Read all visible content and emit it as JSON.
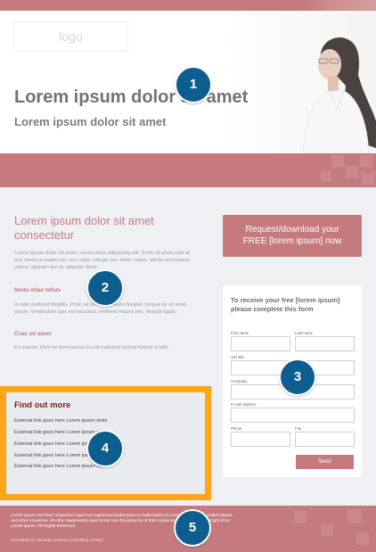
{
  "logo": "logo",
  "hero": {
    "title": "Lorem ipsum dolor sit amet",
    "subtitle": "Lorem ipsum dolor sit amet"
  },
  "main": {
    "title": "Lorem ipsum dolor sit amet consectetur",
    "para1": "Lorem ipsum dolor sit amet, consectetur adipiscing elit. Proin sit amet velit at orci rhoncus mattis nec non nulla. Integer nec dolor metus. Morbi sed mauris varius, aliquam leo et, aliquam dolor.",
    "heading2": "Nulla vitae tellus",
    "para2": "In odio eleifend fringilla. Proin sit sit amet mauris feugiat congue sit sit amet ipsum. Vestibulum quis est faucibus, eleifend massa nec, feugiat ligula.",
    "heading3": "Cras sit amet",
    "para3": "Ex mauris. Duis sit amet purus eu elit euismod lacinia finibus a felis."
  },
  "cta": {
    "line1": "Request/download your",
    "line2": "FREE [lorem ipsum] now"
  },
  "form": {
    "heading": "To receive your free [lorem ipsum] please complete this form",
    "first_name": "First name",
    "last_name": "Last name",
    "job_title": "Job title",
    "company": "Company",
    "email": "E-mail address",
    "phone": "Phone",
    "fax": "Fax",
    "send": "Send"
  },
  "findout": {
    "title": "Find out more",
    "links": [
      "External link goes here Lorem ipsum dolor",
      "External link goes here Lorem ipsum dolor",
      "External link goes here Lorem ipsum dolor",
      "External link goes here Lorem ipsum dolor",
      "External link goes here Lorem ipsum dolor"
    ]
  },
  "footer": {
    "legal": "Lorem ipsum and their respective logos are registered trademarks or trademarks of Lorem ipsum in the United States and other countries. All other trademarks used herein are the property of their respective owners. (c) Copyright 2014 Lorem ipsum. All Rights Reserved.",
    "developer": "Developed by Strategic Internet Consulting Limited"
  },
  "badges": [
    "1",
    "2",
    "3",
    "4",
    "5"
  ],
  "colors": {
    "accent": "#c57b7e",
    "badge": "#0e5d8f",
    "highlight": "#ffa51a",
    "page_bg": "#eef0f3"
  }
}
